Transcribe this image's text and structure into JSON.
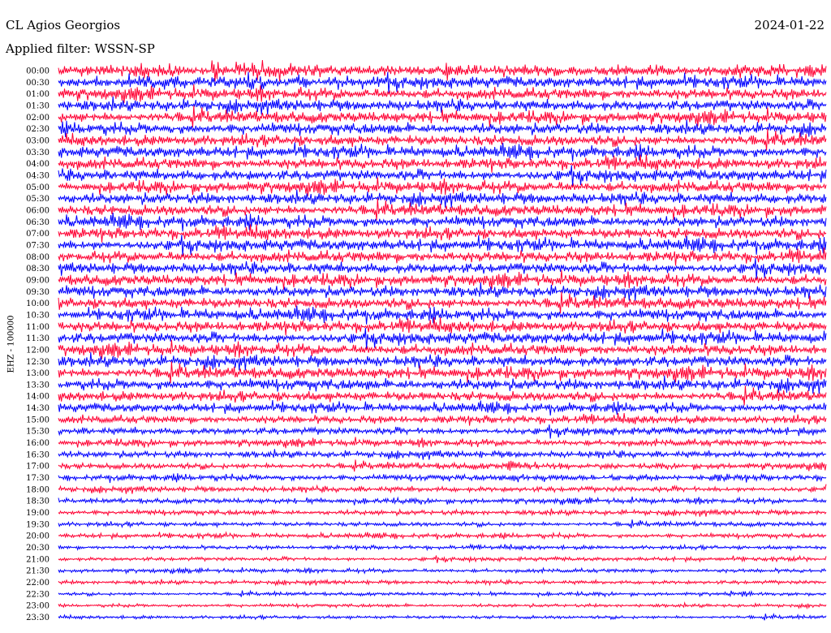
{
  "header": {
    "station": "CL Agios Georgios",
    "date": "2024-01-22",
    "filter": "Applied filter: WSSN-SP"
  },
  "chart_data": {
    "type": "line",
    "subtype": "helicorder",
    "ylabel": "EHZ - 100000",
    "row_interval_minutes": 30,
    "rows": [
      "00:00",
      "00:30",
      "01:00",
      "01:30",
      "02:00",
      "02:30",
      "03:00",
      "03:30",
      "04:00",
      "04:30",
      "05:00",
      "05:30",
      "06:00",
      "06:30",
      "07:00",
      "07:30",
      "08:00",
      "08:30",
      "09:00",
      "09:30",
      "10:00",
      "10:30",
      "11:00",
      "11:30",
      "12:00",
      "12:30",
      "13:00",
      "13:30",
      "14:00",
      "14:30",
      "15:00",
      "15:30",
      "16:00",
      "16:30",
      "17:00",
      "17:30",
      "18:00",
      "18:30",
      "19:00",
      "19:30",
      "20:00",
      "20:30",
      "21:00",
      "21:30",
      "22:00",
      "22:30",
      "23:00",
      "23:30"
    ],
    "trace_colors": [
      "#ff0033",
      "#0000ff"
    ],
    "relative_noise_amplitude": [
      1.0,
      1.0,
      1.0,
      1.0,
      1.0,
      1.0,
      1.0,
      1.0,
      1.0,
      1.0,
      1.0,
      1.0,
      1.0,
      1.0,
      1.0,
      1.0,
      1.0,
      1.0,
      1.0,
      1.0,
      1.0,
      1.0,
      1.0,
      1.0,
      1.0,
      1.0,
      1.0,
      1.0,
      0.9,
      0.8,
      0.7,
      0.65,
      0.6,
      0.6,
      0.55,
      0.55,
      0.5,
      0.45,
      0.45,
      0.4,
      0.4,
      0.35,
      0.35,
      0.35,
      0.35,
      0.3,
      0.3,
      0.3
    ],
    "events": [
      {
        "row": "00:00",
        "minute": 6,
        "relative_amplitude": 2.5
      },
      {
        "row": "00:00",
        "minute": 3,
        "relative_amplitude": 1.6
      },
      {
        "row": "17:00",
        "minute": 17.5,
        "relative_amplitude": 3.0
      },
      {
        "row": "17:30",
        "minute": 17.5,
        "relative_amplitude": 2.5
      },
      {
        "row": "22:30",
        "minute": 26,
        "relative_amplitude": 1.8
      }
    ]
  }
}
